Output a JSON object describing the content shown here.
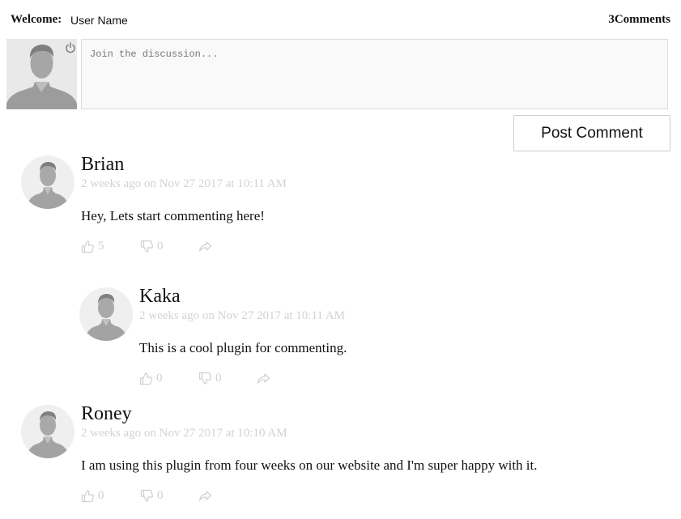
{
  "header": {
    "welcome_label": "Welcome:",
    "user_name": "User Name",
    "comment_count": "3",
    "comments_label": "Comments"
  },
  "composer": {
    "placeholder": "Join the discussion...",
    "post_button": "Post Comment",
    "avatar_icon": "user-avatar",
    "logout_icon": "power-icon"
  },
  "comments": [
    {
      "author": "Brian",
      "time": "2 weeks ago on Nov 27 2017 at 10:11 AM",
      "text": "Hey, Lets start commenting here!",
      "likes": "5",
      "dislikes": "0"
    },
    {
      "author": "Kaka",
      "time": "2 weeks ago on Nov 27 2017 at 10:11 AM",
      "text": "This is a cool plugin for commenting.",
      "likes": "0",
      "dislikes": "0"
    },
    {
      "author": "Roney",
      "time": "2 weeks ago on Nov 27 2017 at 10:10 AM",
      "text": "I am using this plugin from four weeks on our website and I'm super happy with it.",
      "likes": "0",
      "dislikes": "0"
    }
  ],
  "colors": {
    "muted_text": "#d2d2d2",
    "icon_gray": "#cfcfcf",
    "avatar_figure": "#9c9c9c",
    "input_border": "#dcdcdc"
  }
}
